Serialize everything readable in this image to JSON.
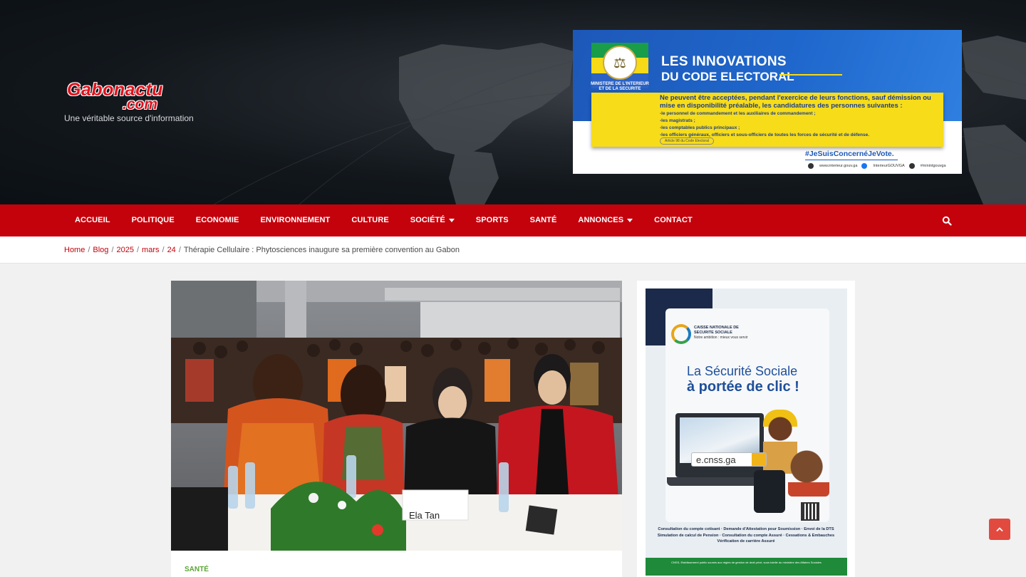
{
  "site": {
    "logo_line1": "Gabonactu",
    "logo_line2": ".com",
    "tagline": "Une véritable source d'information"
  },
  "top_ad": {
    "title_line1": "LES INNOVATIONS",
    "title_line2": "DU CODE ELECTORAL",
    "ministry": "MINISTERE DE L'INTERIEUR ET DE LA SECURITE",
    "intro": "Ne peuvent être acceptées, pendant l'exercice de leurs fonctions, sauf démission ou mise en disponibilité préalable, les candidatures des personnes suivantes :",
    "items": [
      "-le personnel de commandement et les auxiliaires de commandement ;",
      "-les magistrats ;",
      "-les comptables publics principaux ;",
      "-les officiers généraux, officiers et sous-officiers de toutes les forces de sécurité et de défense."
    ],
    "article_ref": "Article 98 du Code Electoral",
    "hashtag": "#JeSuisConcernéJeVote.",
    "social": [
      "www.interieur.gouv.ga",
      "InterieurGOUVGA",
      "#minintgouvga"
    ],
    "colors": {
      "blue": "#1f67cc",
      "yellow": "#f7dc1a",
      "green": "#199d48"
    }
  },
  "nav": {
    "items": [
      {
        "label": "ACCUEIL",
        "has_dropdown": false
      },
      {
        "label": "POLITIQUE",
        "has_dropdown": false
      },
      {
        "label": "ECONOMIE",
        "has_dropdown": false
      },
      {
        "label": "ENVIRONNEMENT",
        "has_dropdown": false
      },
      {
        "label": "CULTURE",
        "has_dropdown": false
      },
      {
        "label": "SOCIÉTÉ",
        "has_dropdown": true
      },
      {
        "label": "SPORTS",
        "has_dropdown": false
      },
      {
        "label": "SANTÉ",
        "has_dropdown": false
      },
      {
        "label": "ANNONCES",
        "has_dropdown": true
      },
      {
        "label": "CONTACT",
        "has_dropdown": false
      }
    ],
    "search_icon": "search-icon",
    "color": "#c4020c"
  },
  "breadcrumb": {
    "links": [
      "Home",
      "Blog",
      "2025",
      "mars",
      "24"
    ],
    "current": "Thérapie Cellulaire : Phytosciences inaugure sa première convention au Gabon"
  },
  "article": {
    "category": "SANTÉ",
    "photo_nameplate": "Ela Tan"
  },
  "sidebar_ad": {
    "org_name": "CAISSE NATIONALE DE SECURITE SOCIALE",
    "org_motto": "Notre ambition : mieux vous servir",
    "headline_line1": "La Sécurité Sociale",
    "headline_line2": "à portée de clic !",
    "search_text": "e.cnss.ga",
    "services": [
      "Consultation du compte cotisant · Demande d'Attestation pour Soumission · Envoi de la DTS",
      "Simulation de calcul de Pension · Consultation du compte Assuré · Cessations & Embauches",
      "Vérification de carrière Assuré"
    ],
    "footer": "CNSS, Etablissement public soumis aux règles de gestion de droit privé, sous tutelle du ministère des Affaires Sociales"
  },
  "scroll_top_icon": "arrow-up-icon"
}
